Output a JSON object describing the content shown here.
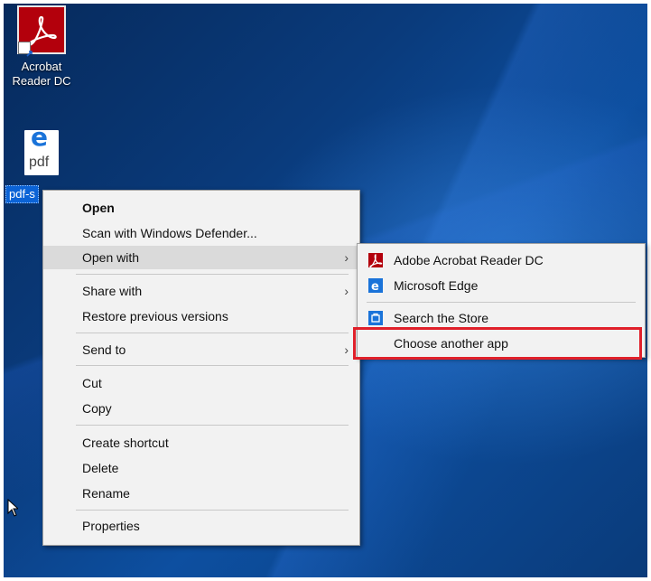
{
  "desktop": {
    "icons": [
      {
        "label_line1": "Acrobat",
        "label_line2": "Reader DC"
      },
      {
        "file_ext": "pdf",
        "label": "pdf-s"
      }
    ]
  },
  "context_menu": {
    "items": [
      {
        "label": "Open"
      },
      {
        "label": "Scan with Windows Defender..."
      },
      {
        "label": "Open with"
      },
      {
        "label": "Share with"
      },
      {
        "label": "Restore previous versions"
      },
      {
        "label": "Send to"
      },
      {
        "label": "Cut"
      },
      {
        "label": "Copy"
      },
      {
        "label": "Create shortcut"
      },
      {
        "label": "Delete"
      },
      {
        "label": "Rename"
      },
      {
        "label": "Properties"
      }
    ],
    "submenu_arrow": "›"
  },
  "submenu": {
    "items": [
      {
        "label": "Adobe Acrobat Reader DC",
        "icon": "acrobat-icon"
      },
      {
        "label": "Microsoft Edge",
        "icon": "edge-icon"
      },
      {
        "label": "Search the Store",
        "icon": "store-icon"
      },
      {
        "label": "Choose another app"
      }
    ]
  },
  "colors": {
    "highlight_box": "#e0202a",
    "menu_bg": "#f2f2f2",
    "hover_bg": "#dadada",
    "acrobat_red": "#b3000c"
  }
}
